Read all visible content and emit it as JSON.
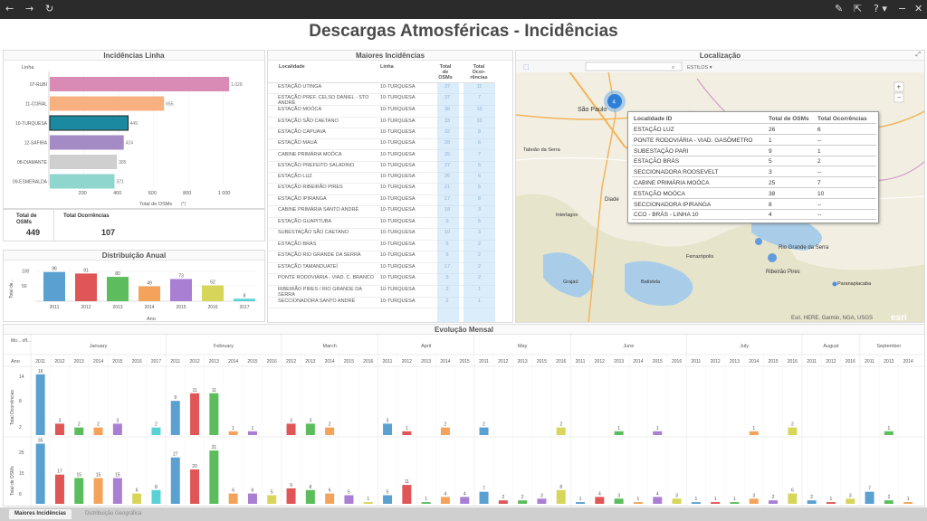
{
  "topbar": {
    "back": "←",
    "forward": "→",
    "reload": "↻",
    "edit": "✎",
    "share": "⇱",
    "help": "? ▾",
    "minimize": "−",
    "close": "✕"
  },
  "title": "Descargas Atmosféricas - Incidências",
  "incidencias_linha": {
    "title": "Incidências Linha",
    "col_label": "Linha",
    "axis_label": "Total de OSMs",
    "axis_suffix": "(*)",
    "rows": [
      {
        "label": "07-RUBI",
        "value": 1028,
        "vlabel": "1.028",
        "color": "#d98bb5"
      },
      {
        "label": "11-CORAL",
        "value": 655,
        "vlabel": "655",
        "color": "#f7b07f"
      },
      {
        "label": "10-TURQUESA",
        "value": 449,
        "vlabel": "449",
        "color": "#1b8aa0"
      },
      {
        "label": "12-SAFIRA",
        "value": 424,
        "vlabel": "424",
        "color": "#a58bc6"
      },
      {
        "label": "08-DIAMANTE",
        "value": 385,
        "vlabel": "385",
        "color": "#cfcfcf"
      },
      {
        "label": "09-ESMERALDA",
        "value": 371,
        "vlabel": "371",
        "color": "#8fd6cf"
      }
    ],
    "ticks": [
      "200",
      "400",
      "600",
      "800",
      "1 000"
    ]
  },
  "kpi": {
    "osm_label": "Total de OSMs",
    "osm_value": "449",
    "occ_label": "Total Ocorrências",
    "occ_value": "107"
  },
  "distribuicao_anual": {
    "title": "Distribuição Anual",
    "ylabel": "Total de...",
    "xlabel": "Ano",
    "yticks": [
      "50",
      "100"
    ],
    "bars": [
      {
        "year": "2011",
        "value": 96,
        "color": "#5aa0d0"
      },
      {
        "year": "2012",
        "value": 91,
        "color": "#e05555"
      },
      {
        "year": "2013",
        "value": 80,
        "color": "#5bbd5b"
      },
      {
        "year": "2014",
        "value": 49,
        "color": "#f5a35a"
      },
      {
        "year": "2015",
        "value": 73,
        "color": "#a97fd4"
      },
      {
        "year": "2016",
        "value": 52,
        "color": "#d7d65a"
      },
      {
        "year": "2017",
        "value": 8,
        "color": "#5ad1d7"
      }
    ]
  },
  "maiores": {
    "title": "Maiores Incidências",
    "h_local": "Localidade",
    "h_linha": "Linha",
    "h_osm": "Total de OSMs",
    "h_occ": "Total Ocor-rências",
    "rows": [
      {
        "local": "ESTAÇÃO UTINGA",
        "linha": "10-TURQUESA",
        "osm": "37",
        "occ": "11"
      },
      {
        "local": "ESTAÇÃO PREF. CELSO DANIEL - STO ANDRÉ",
        "linha": "10-TURQUESA",
        "osm": "37",
        "occ": "7"
      },
      {
        "local": "ESTAÇÃO MOÓCA",
        "linha": "10-TURQUESA",
        "osm": "38",
        "occ": "10"
      },
      {
        "local": "ESTAÇÃO SÃO CAETANO",
        "linha": "10-TURQUESA",
        "osm": "33",
        "occ": "10"
      },
      {
        "local": "ESTAÇÃO CAPUAVA",
        "linha": "10-TURQUESA",
        "osm": "32",
        "occ": "8"
      },
      {
        "local": "ESTAÇÃO MAUÁ",
        "linha": "10-TURQUESA",
        "osm": "28",
        "occ": "6"
      },
      {
        "local": "CABINE PRIMÁRIA MOÓCA",
        "linha": "10-TURQUESA",
        "osm": "25",
        "occ": "7"
      },
      {
        "local": "ESTAÇÃO PREFEITO SALADINO",
        "linha": "10-TURQUESA",
        "osm": "27",
        "occ": "5"
      },
      {
        "local": "ESTAÇÃO LUZ",
        "linha": "10-TURQUESA",
        "osm": "26",
        "occ": "6"
      },
      {
        "local": "ESTAÇÃO RIBEIRÃO PIRES",
        "linha": "10-TURQUESA",
        "osm": "21",
        "occ": "5"
      },
      {
        "local": "ESTAÇÃO IPIRANGA",
        "linha": "10-TURQUESA",
        "osm": "17",
        "occ": "8"
      },
      {
        "local": "CABINE PRIMÁRIA SANTO ANDRÉ",
        "linha": "10-TURQUESA",
        "osm": "18",
        "occ": "3"
      },
      {
        "local": "ESTAÇÃO GUAPITUBA",
        "linha": "10-TURQUESA",
        "osm": "9",
        "occ": "5"
      },
      {
        "local": "SUBESTAÇÃO SÃO CAETANO",
        "linha": "10-TURQUESA",
        "osm": "10",
        "occ": "3"
      },
      {
        "local": "ESTAÇÃO BRÁS",
        "linha": "10-TURQUESA",
        "osm": "5",
        "occ": "2"
      },
      {
        "local": "ESTAÇÃO RIO GRANDE DA SERRA",
        "linha": "10-TURQUESA",
        "osm": "6",
        "occ": "2"
      },
      {
        "local": "ESTAÇÃO TAMANDUATEÍ",
        "linha": "10-TURQUESA",
        "osm": "17",
        "occ": "2"
      },
      {
        "local": "PONTE RODOVIÁRIA - VIAD. C. BRANCO",
        "linha": "10-TURQUESA",
        "osm": "5",
        "occ": "2"
      },
      {
        "local": "RIBEIRÃO PIRES / RIO GRANDE DA SERRA",
        "linha": "10-TURQUESA",
        "osm": "2",
        "occ": "1"
      },
      {
        "local": "SECCIONADORA SANTO ANDRÉ",
        "linha": "10-TURQUESA",
        "osm": "2",
        "occ": "1"
      }
    ]
  },
  "mapa": {
    "title": "Localização",
    "search_placeholder": "",
    "styles": "ESTILOS ▾",
    "cluster": "4",
    "attribution": "Esri, HERE, Garmin, NGA, USGS",
    "esri": "esri",
    "labels": [
      {
        "t": "São Paulo"
      },
      {
        "t": "Ribeirão Pires"
      },
      {
        "t": "Rio Grande da Serra"
      },
      {
        "t": "Diade"
      },
      {
        "t": "Ferrazópolis"
      },
      {
        "t": "Paranapiacaba"
      },
      {
        "t": "Grajaú"
      },
      {
        "t": "Batistela"
      },
      {
        "t": "Interlagos"
      },
      {
        "t": "Taboão da Serra"
      }
    ],
    "popup": {
      "h1": "Localidade ID",
      "h2": "Total de OSMs",
      "h3": "Total Ocorrências",
      "rows": [
        {
          "a": "ESTAÇÃO LUZ",
          "b": "26",
          "c": "6"
        },
        {
          "a": "PONTE RODOVIÁRIA - VIAD. GASÔMETRO",
          "b": "1",
          "c": "--"
        },
        {
          "a": "SUBESTAÇÃO PARI",
          "b": "9",
          "c": "1"
        },
        {
          "a": "ESTAÇÃO BRÁS",
          "b": "5",
          "c": "2"
        },
        {
          "a": "SECCIONADORA ROOSEVELT",
          "b": "3",
          "c": "--"
        },
        {
          "a": "CABINE PRIMÁRIA MOÓCA",
          "b": "25",
          "c": "7"
        },
        {
          "a": "ESTAÇÃO MOÓCA",
          "b": "38",
          "c": "10"
        },
        {
          "a": "SECCIONADORA IPIRANGA",
          "b": "8",
          "c": "--"
        },
        {
          "a": "CCO - BRÁS - LINHA 10",
          "b": "4",
          "c": "--"
        }
      ]
    }
  },
  "evolucao": {
    "title": "Evolução Mensal",
    "corner": "Mo... off...",
    "ano_label": "Ano",
    "ylabel_top": "Total Ocorrências",
    "ylabel_bottom": "Total de OSMs",
    "months": [
      {
        "name": "January",
        "years": [
          "2011",
          "2012",
          "2013",
          "2014",
          "2015",
          "2016",
          "2017"
        ]
      },
      {
        "name": "February",
        "years": [
          "2011",
          "2012",
          "2013",
          "2014",
          "2015",
          "2016"
        ]
      },
      {
        "name": "March",
        "years": [
          "2012",
          "2013",
          "2014",
          "2015",
          "2016"
        ]
      },
      {
        "name": "April",
        "years": [
          "2011",
          "2012",
          "2013",
          "2014",
          "2015"
        ]
      },
      {
        "name": "May",
        "years": [
          "2011",
          "2012",
          "2013",
          "2015",
          "2016"
        ]
      },
      {
        "name": "June",
        "years": [
          "2011",
          "2012",
          "2013",
          "2014",
          "2015",
          "2016"
        ]
      },
      {
        "name": "July",
        "years": [
          "2011",
          "2012",
          "2013",
          "2014",
          "2015",
          "2016"
        ]
      },
      {
        "name": "August",
        "years": [
          "2011",
          "2012",
          "2016"
        ]
      },
      {
        "name": "September",
        "years": [
          "2011",
          "2013",
          "2014"
        ]
      }
    ],
    "occ": [
      16,
      3,
      2,
      2,
      3,
      null,
      2,
      9,
      11,
      11,
      1,
      1,
      null,
      3,
      3,
      2,
      null,
      null,
      3,
      1,
      null,
      2,
      null,
      2,
      null,
      null,
      null,
      2,
      null,
      null,
      1,
      null,
      1,
      null,
      null,
      null,
      null,
      1,
      null,
      2,
      null,
      null,
      null,
      null,
      1,
      null
    ],
    "osm": [
      35,
      17,
      15,
      15,
      15,
      6,
      8,
      27,
      20,
      31,
      6,
      6,
      5,
      9,
      8,
      6,
      5,
      1,
      5,
      11,
      1,
      4,
      4,
      7,
      2,
      2,
      3,
      8,
      1,
      4,
      3,
      1,
      4,
      3,
      1,
      1,
      1,
      3,
      2,
      6,
      2,
      1,
      3,
      7,
      2,
      1
    ]
  },
  "tabs": {
    "t1": "Maiores Incidências",
    "t2": "Distribuição Geográfica"
  },
  "colors": {
    "years": {
      "2011": "#5aa0d0",
      "2012": "#e05555",
      "2013": "#5bbd5b",
      "2014": "#f5a35a",
      "2015": "#a97fd4",
      "2016": "#d7d65a",
      "2017": "#5ad1d7"
    }
  }
}
